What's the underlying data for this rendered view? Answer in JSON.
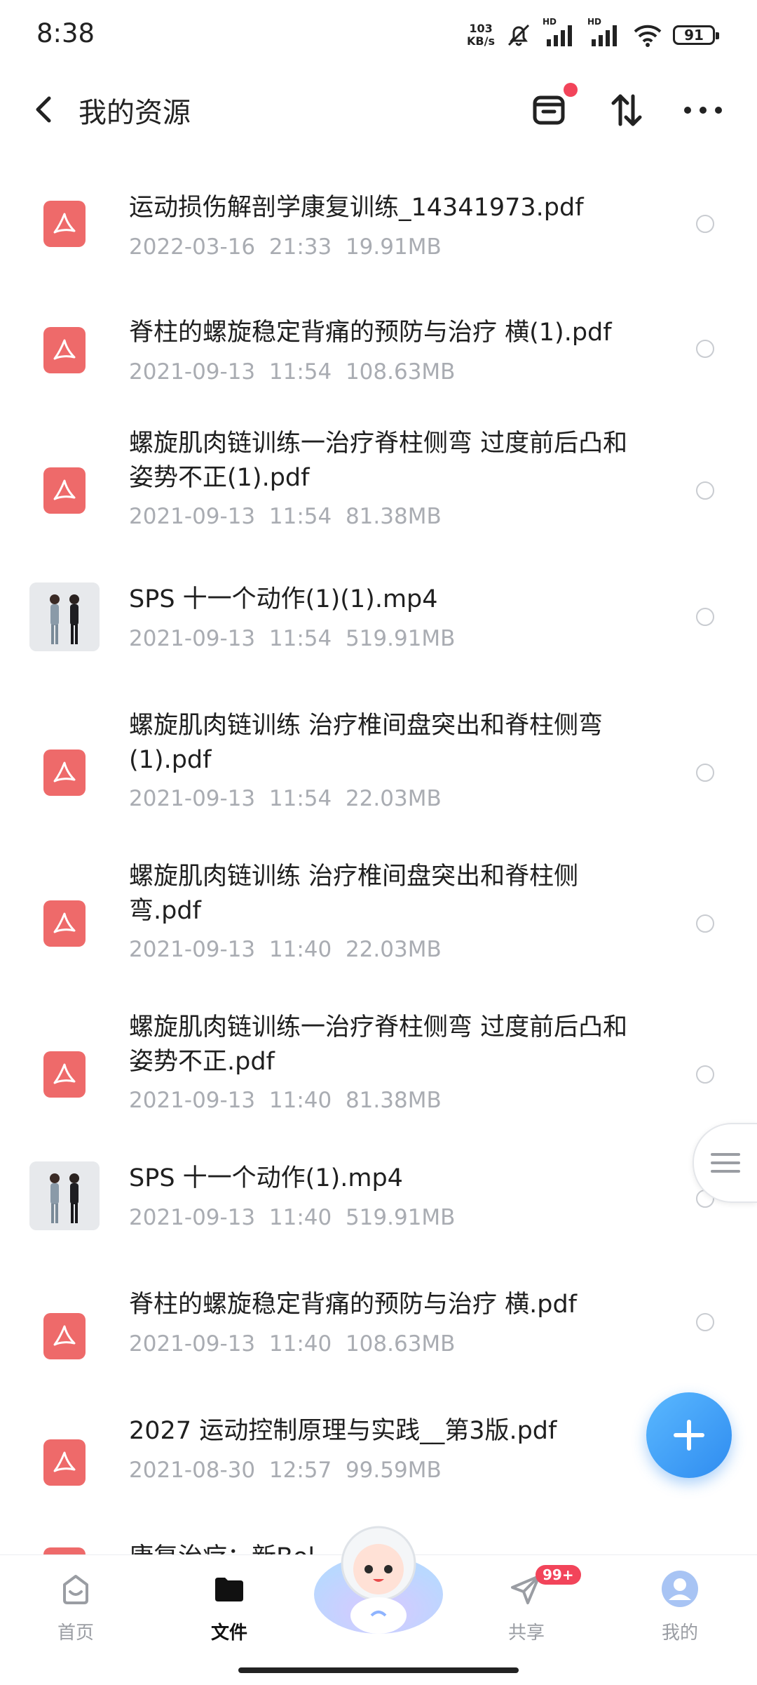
{
  "status_bar": {
    "time": "8:38",
    "net_speed_value": "103",
    "net_speed_unit": "KB/s",
    "hd1": "HD",
    "hd2": "HD",
    "battery": "91"
  },
  "header": {
    "title": "我的资源",
    "back_icon": "back-arrow-icon",
    "icons": [
      "recycle-box-icon",
      "sort-icon",
      "more-icon"
    ]
  },
  "files": [
    {
      "name": "运动损伤解剖学康复训练_14341973.pdf",
      "date": "2022-03-16",
      "time": "21:33",
      "size": "19.91MB",
      "type": "pdf"
    },
    {
      "name": "脊柱的螺旋稳定背痛的预防与治疗 横(1).pdf",
      "date": "2021-09-13",
      "time": "11:54",
      "size": "108.63MB",
      "type": "pdf"
    },
    {
      "name": "螺旋肌肉链训练一治疗脊柱侧弯 过度前后凸和姿势不正(1).pdf",
      "date": "2021-09-13",
      "time": "11:54",
      "size": "81.38MB",
      "type": "pdf"
    },
    {
      "name": "SPS 十一个动作(1)(1).mp4",
      "date": "2021-09-13",
      "time": "11:54",
      "size": "519.91MB",
      "type": "video"
    },
    {
      "name": "螺旋肌肉链训练 治疗椎间盘突出和脊柱侧弯(1).pdf",
      "date": "2021-09-13",
      "time": "11:54",
      "size": "22.03MB",
      "type": "pdf"
    },
    {
      "name": "螺旋肌肉链训练 治疗椎间盘突出和脊柱侧弯.pdf",
      "date": "2021-09-13",
      "time": "11:40",
      "size": "22.03MB",
      "type": "pdf"
    },
    {
      "name": "螺旋肌肉链训练一治疗脊柱侧弯 过度前后凸和姿势不正.pdf",
      "date": "2021-09-13",
      "time": "11:40",
      "size": "81.38MB",
      "type": "pdf"
    },
    {
      "name": "SPS 十一个动作(1).mp4",
      "date": "2021-09-13",
      "time": "11:40",
      "size": "519.91MB",
      "type": "video"
    },
    {
      "name": "脊柱的螺旋稳定背痛的预防与治疗 横.pdf",
      "date": "2021-09-13",
      "time": "11:40",
      "size": "108.63MB",
      "type": "pdf"
    },
    {
      "name": "2027 运动控制原理与实践__第3版.pdf",
      "date": "2021-08-30",
      "time": "12:57",
      "size": "99.59MB",
      "type": "pdf"
    },
    {
      "name": "康复治疗：新Bol...",
      "date": "",
      "time": "",
      "size": "",
      "type": "pdf"
    }
  ],
  "nav": {
    "home": "首页",
    "files": "文件",
    "share": "共享",
    "mine": "我的",
    "share_badge": "99+"
  },
  "colors": {
    "accent": "#2f8cf0",
    "pdf": "#ee6a6a",
    "badge": "#f2445a",
    "meta_text": "#a9acb2"
  }
}
